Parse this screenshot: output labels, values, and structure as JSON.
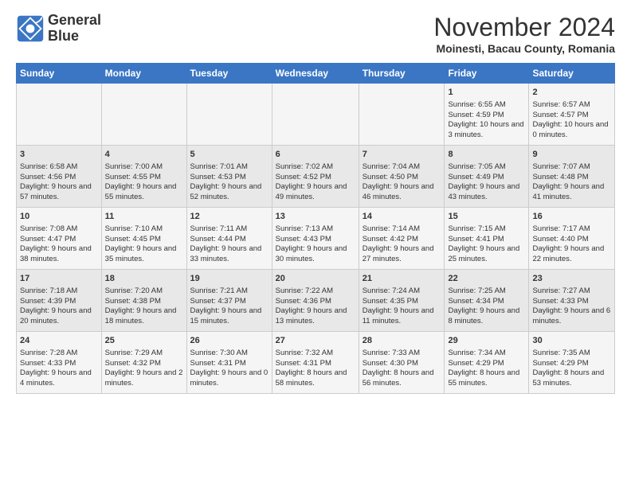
{
  "header": {
    "logo_line1": "General",
    "logo_line2": "Blue",
    "month_title": "November 2024",
    "location": "Moinesti, Bacau County, Romania"
  },
  "weekdays": [
    "Sunday",
    "Monday",
    "Tuesday",
    "Wednesday",
    "Thursday",
    "Friday",
    "Saturday"
  ],
  "weeks": [
    [
      {
        "day": "",
        "info": ""
      },
      {
        "day": "",
        "info": ""
      },
      {
        "day": "",
        "info": ""
      },
      {
        "day": "",
        "info": ""
      },
      {
        "day": "",
        "info": ""
      },
      {
        "day": "1",
        "info": "Sunrise: 6:55 AM\nSunset: 4:59 PM\nDaylight: 10 hours and 3 minutes."
      },
      {
        "day": "2",
        "info": "Sunrise: 6:57 AM\nSunset: 4:57 PM\nDaylight: 10 hours and 0 minutes."
      }
    ],
    [
      {
        "day": "3",
        "info": "Sunrise: 6:58 AM\nSunset: 4:56 PM\nDaylight: 9 hours and 57 minutes."
      },
      {
        "day": "4",
        "info": "Sunrise: 7:00 AM\nSunset: 4:55 PM\nDaylight: 9 hours and 55 minutes."
      },
      {
        "day": "5",
        "info": "Sunrise: 7:01 AM\nSunset: 4:53 PM\nDaylight: 9 hours and 52 minutes."
      },
      {
        "day": "6",
        "info": "Sunrise: 7:02 AM\nSunset: 4:52 PM\nDaylight: 9 hours and 49 minutes."
      },
      {
        "day": "7",
        "info": "Sunrise: 7:04 AM\nSunset: 4:50 PM\nDaylight: 9 hours and 46 minutes."
      },
      {
        "day": "8",
        "info": "Sunrise: 7:05 AM\nSunset: 4:49 PM\nDaylight: 9 hours and 43 minutes."
      },
      {
        "day": "9",
        "info": "Sunrise: 7:07 AM\nSunset: 4:48 PM\nDaylight: 9 hours and 41 minutes."
      }
    ],
    [
      {
        "day": "10",
        "info": "Sunrise: 7:08 AM\nSunset: 4:47 PM\nDaylight: 9 hours and 38 minutes."
      },
      {
        "day": "11",
        "info": "Sunrise: 7:10 AM\nSunset: 4:45 PM\nDaylight: 9 hours and 35 minutes."
      },
      {
        "day": "12",
        "info": "Sunrise: 7:11 AM\nSunset: 4:44 PM\nDaylight: 9 hours and 33 minutes."
      },
      {
        "day": "13",
        "info": "Sunrise: 7:13 AM\nSunset: 4:43 PM\nDaylight: 9 hours and 30 minutes."
      },
      {
        "day": "14",
        "info": "Sunrise: 7:14 AM\nSunset: 4:42 PM\nDaylight: 9 hours and 27 minutes."
      },
      {
        "day": "15",
        "info": "Sunrise: 7:15 AM\nSunset: 4:41 PM\nDaylight: 9 hours and 25 minutes."
      },
      {
        "day": "16",
        "info": "Sunrise: 7:17 AM\nSunset: 4:40 PM\nDaylight: 9 hours and 22 minutes."
      }
    ],
    [
      {
        "day": "17",
        "info": "Sunrise: 7:18 AM\nSunset: 4:39 PM\nDaylight: 9 hours and 20 minutes."
      },
      {
        "day": "18",
        "info": "Sunrise: 7:20 AM\nSunset: 4:38 PM\nDaylight: 9 hours and 18 minutes."
      },
      {
        "day": "19",
        "info": "Sunrise: 7:21 AM\nSunset: 4:37 PM\nDaylight: 9 hours and 15 minutes."
      },
      {
        "day": "20",
        "info": "Sunrise: 7:22 AM\nSunset: 4:36 PM\nDaylight: 9 hours and 13 minutes."
      },
      {
        "day": "21",
        "info": "Sunrise: 7:24 AM\nSunset: 4:35 PM\nDaylight: 9 hours and 11 minutes."
      },
      {
        "day": "22",
        "info": "Sunrise: 7:25 AM\nSunset: 4:34 PM\nDaylight: 9 hours and 8 minutes."
      },
      {
        "day": "23",
        "info": "Sunrise: 7:27 AM\nSunset: 4:33 PM\nDaylight: 9 hours and 6 minutes."
      }
    ],
    [
      {
        "day": "24",
        "info": "Sunrise: 7:28 AM\nSunset: 4:33 PM\nDaylight: 9 hours and 4 minutes."
      },
      {
        "day": "25",
        "info": "Sunrise: 7:29 AM\nSunset: 4:32 PM\nDaylight: 9 hours and 2 minutes."
      },
      {
        "day": "26",
        "info": "Sunrise: 7:30 AM\nSunset: 4:31 PM\nDaylight: 9 hours and 0 minutes."
      },
      {
        "day": "27",
        "info": "Sunrise: 7:32 AM\nSunset: 4:31 PM\nDaylight: 8 hours and 58 minutes."
      },
      {
        "day": "28",
        "info": "Sunrise: 7:33 AM\nSunset: 4:30 PM\nDaylight: 8 hours and 56 minutes."
      },
      {
        "day": "29",
        "info": "Sunrise: 7:34 AM\nSunset: 4:29 PM\nDaylight: 8 hours and 55 minutes."
      },
      {
        "day": "30",
        "info": "Sunrise: 7:35 AM\nSunset: 4:29 PM\nDaylight: 8 hours and 53 minutes."
      }
    ]
  ]
}
